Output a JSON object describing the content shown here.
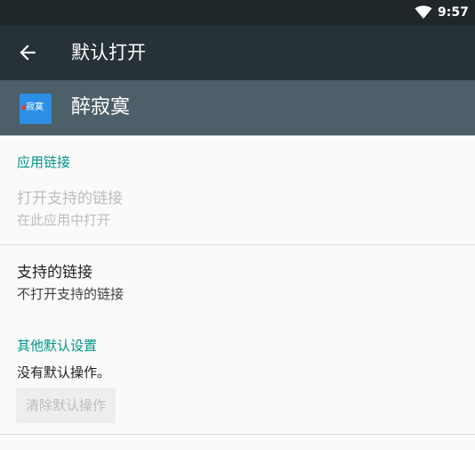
{
  "status_bar": {
    "time": "9:57",
    "wifi_icon": "wifi-icon"
  },
  "toolbar": {
    "back_icon": "arrow-back-icon",
    "title": "默认打开"
  },
  "app": {
    "name": "醉寂寞",
    "icon_text": "寂寞"
  },
  "sections": {
    "app_links_header": "应用链接",
    "open_supported_links_title": "打开支持的链接",
    "open_supported_links_summary": "在此应用中打开",
    "supported_links_title": "支持的链接",
    "supported_links_summary": "不打开支持的链接",
    "other_defaults_header": "其他默认设置",
    "no_defaults_text": "没有默认操作。",
    "clear_defaults_button": "清除默认操作"
  },
  "colors": {
    "status_bar": "#1f272a",
    "toolbar": "#263238",
    "app_header": "#4d5f68",
    "accent": "#009688",
    "background": "#fafafa"
  }
}
